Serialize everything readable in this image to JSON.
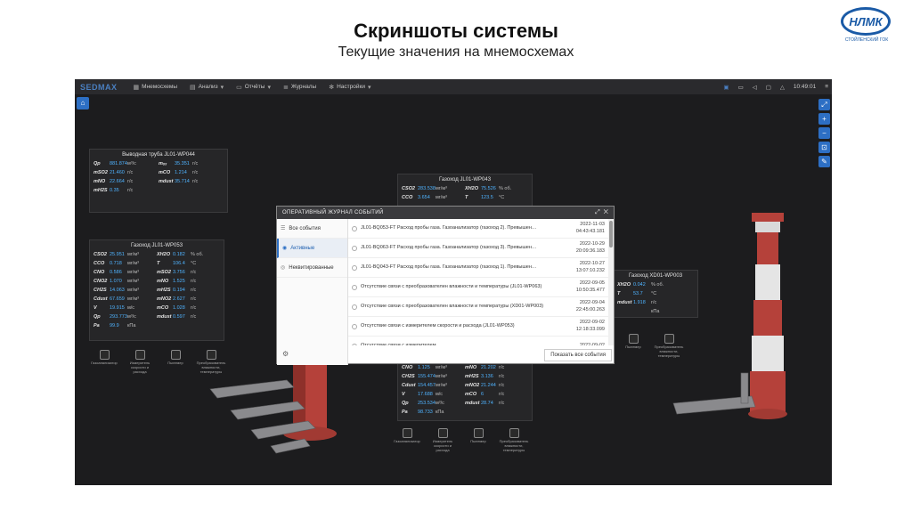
{
  "slide": {
    "title": "Скриншоты системы",
    "subtitle": "Текущие значения на мнемосхемах",
    "logo_text": "НЛМК",
    "logo_sub": "стойленский гок"
  },
  "app": {
    "brand": "SEDMAX",
    "menu": [
      "Мнемосхемы",
      "Анализ",
      "Отчёты",
      "Журналы",
      "Настройки"
    ],
    "clock": "10:49:01",
    "accent": "#2d6fc4"
  },
  "panels": {
    "wp044": {
      "title": "Выводная труба JL01-WP044",
      "rows": [
        [
          {
            "l": "Qp",
            "v": "881.874",
            "u": "м³/с"
          },
          {
            "l": "mₒₓ",
            "v": "35.351",
            "u": "г/с"
          }
        ],
        [
          {
            "l": "mSO2",
            "v": "21.460",
            "u": "г/с"
          },
          {
            "l": "mCO",
            "v": "1.214",
            "u": "г/с"
          }
        ],
        [
          {
            "l": "mNO",
            "v": "22.664",
            "u": "г/с"
          },
          {
            "l": "mdust",
            "v": "35.714",
            "u": "г/с"
          }
        ],
        [
          {
            "l": "mH2S",
            "v": "0.35",
            "u": "г/с"
          },
          {
            "l": "",
            "v": "",
            "u": ""
          }
        ]
      ]
    },
    "wp053": {
      "title": "Газоход JL01-WP053",
      "rows": [
        [
          {
            "l": "CSO2",
            "v": "25.951",
            "u": "мг/м³"
          },
          {
            "l": "XH2O",
            "v": "0.182",
            "u": "% об."
          }
        ],
        [
          {
            "l": "CCO",
            "v": "0.718",
            "u": "мг/м³"
          },
          {
            "l": "T",
            "v": "106.4",
            "u": "°C"
          }
        ],
        [
          {
            "l": "CNO",
            "v": "0.586",
            "u": "мг/м³"
          },
          {
            "l": "mSO2",
            "v": "3.756",
            "u": "г/с"
          }
        ],
        [
          {
            "l": "CNO2",
            "v": "1.070",
            "u": "мг/м³"
          },
          {
            "l": "mNO",
            "v": "1.525",
            "u": "г/с"
          }
        ],
        [
          {
            "l": "CH2S",
            "v": "14.063",
            "u": "мг/м³"
          },
          {
            "l": "mH2S",
            "v": "0.194",
            "u": "г/с"
          }
        ],
        [
          {
            "l": "Cdust",
            "v": "67.659",
            "u": "мг/м³"
          },
          {
            "l": "mNO2",
            "v": "2.627",
            "u": "г/с"
          }
        ],
        [
          {
            "l": "V",
            "v": "19.915",
            "u": "м/с"
          },
          {
            "l": "mCO",
            "v": "1.028",
            "u": "г/с"
          }
        ],
        [
          {
            "l": "Qp",
            "v": "293.773",
            "u": "м³/с"
          },
          {
            "l": "mdust",
            "v": "0.597",
            "u": "г/с"
          }
        ],
        [
          {
            "l": "Pa",
            "v": "99.9",
            "u": "кПа"
          },
          {
            "l": "",
            "v": "",
            "u": ""
          }
        ]
      ]
    },
    "wp043": {
      "title": "Газоход JL01-WP043",
      "rows": [
        [
          {
            "l": "CSO2",
            "v": "283.538",
            "u": "мг/м³"
          },
          {
            "l": "XH2O",
            "v": "75.526",
            "u": "% об."
          }
        ],
        [
          {
            "l": "CCO",
            "v": "3.654",
            "u": "мг/м³"
          },
          {
            "l": "T",
            "v": "123.5",
            "u": "°C"
          }
        ]
      ]
    },
    "wp003": {
      "title": "Газоход XD01-WP003",
      "rows": [
        [
          {
            "l": "XH2O",
            "v": "0.042",
            "u": "% об."
          }
        ],
        [
          {
            "l": "T",
            "v": "53.7",
            "u": "°C"
          }
        ],
        [
          {
            "l": "mdust",
            "v": "1.918",
            "u": "г/с"
          }
        ],
        [
          {
            "l": "",
            "v": "",
            "u": "кПа"
          }
        ]
      ]
    },
    "wp043b": {
      "rows": [
        [
          {
            "l": "CNO",
            "v": "1.125",
            "u": "мг/м³"
          },
          {
            "l": "mNO",
            "v": "21.202",
            "u": "г/с"
          }
        ],
        [
          {
            "l": "CH2S",
            "v": "155.474",
            "u": "мг/м³"
          },
          {
            "l": "mH2S",
            "v": "3.136",
            "u": "г/с"
          }
        ],
        [
          {
            "l": "Cdust",
            "v": "154.457",
            "u": "мг/м³"
          },
          {
            "l": "mNO2",
            "v": "21.244",
            "u": "г/с"
          }
        ],
        [
          {
            "l": "V",
            "v": "17.688",
            "u": "м/с"
          },
          {
            "l": "mCO",
            "v": "6",
            "u": "г/с"
          }
        ],
        [
          {
            "l": "Qp",
            "v": "253.534",
            "u": "м³/с"
          },
          {
            "l": "mdust",
            "v": "28.74",
            "u": "г/с"
          }
        ],
        [
          {
            "l": "Pa",
            "v": "98.733",
            "u": "кПа"
          },
          {
            "l": "",
            "v": "",
            "u": ""
          }
        ]
      ]
    }
  },
  "devices": [
    "Газоанализатор",
    "Измеритель скорости и расхода",
    "Пылемер",
    "Преобразователь влажности, температуры"
  ],
  "devices_right": [
    "Пылемер",
    "Преобразователь влажности, температуры"
  ],
  "modal": {
    "title": "ОПЕРАТИВНЫЙ ЖУРНАЛ СОБЫТИЙ",
    "tabs": [
      "Все события",
      "Активные",
      "Неквитированные"
    ],
    "events": [
      {
        "text": "JL01-BQ053-FT Расход пробы газа. Газоанализатор (газоход 2). Превышен…",
        "date": "2022-11-03",
        "time": "04:43:43.181"
      },
      {
        "text": "JL01-BQ063-FT Расход пробы газа. Газоанализатор (газоход 3). Превышен…",
        "date": "2022-10-29",
        "time": "20:09:36.183"
      },
      {
        "text": "JL01-BQ043-FT Расход пробы газа. Газоанализатор (газоход 1). Превышен…",
        "date": "2022-10-27",
        "time": "13:07:10.232"
      },
      {
        "text": "Отсутствие связи с преобразователен влажности и температуры (JL01-WP063)",
        "date": "2022-09-05",
        "time": "10:50:35.477"
      },
      {
        "text": "Отсутствие связи с преобразователен влажности и температуры (XD01-WP003)",
        "date": "2022-09-04",
        "time": "22:45:00.263"
      },
      {
        "text": "Отсутствие связи с измерителем скорости и расхода (JL01-WP053)",
        "date": "2022-09-02",
        "time": "12:18:33.099"
      },
      {
        "text": "Отсутствие связи с измерителем",
        "date": "2022-09-02",
        "time": ""
      }
    ],
    "show_all": "Показать все события"
  }
}
